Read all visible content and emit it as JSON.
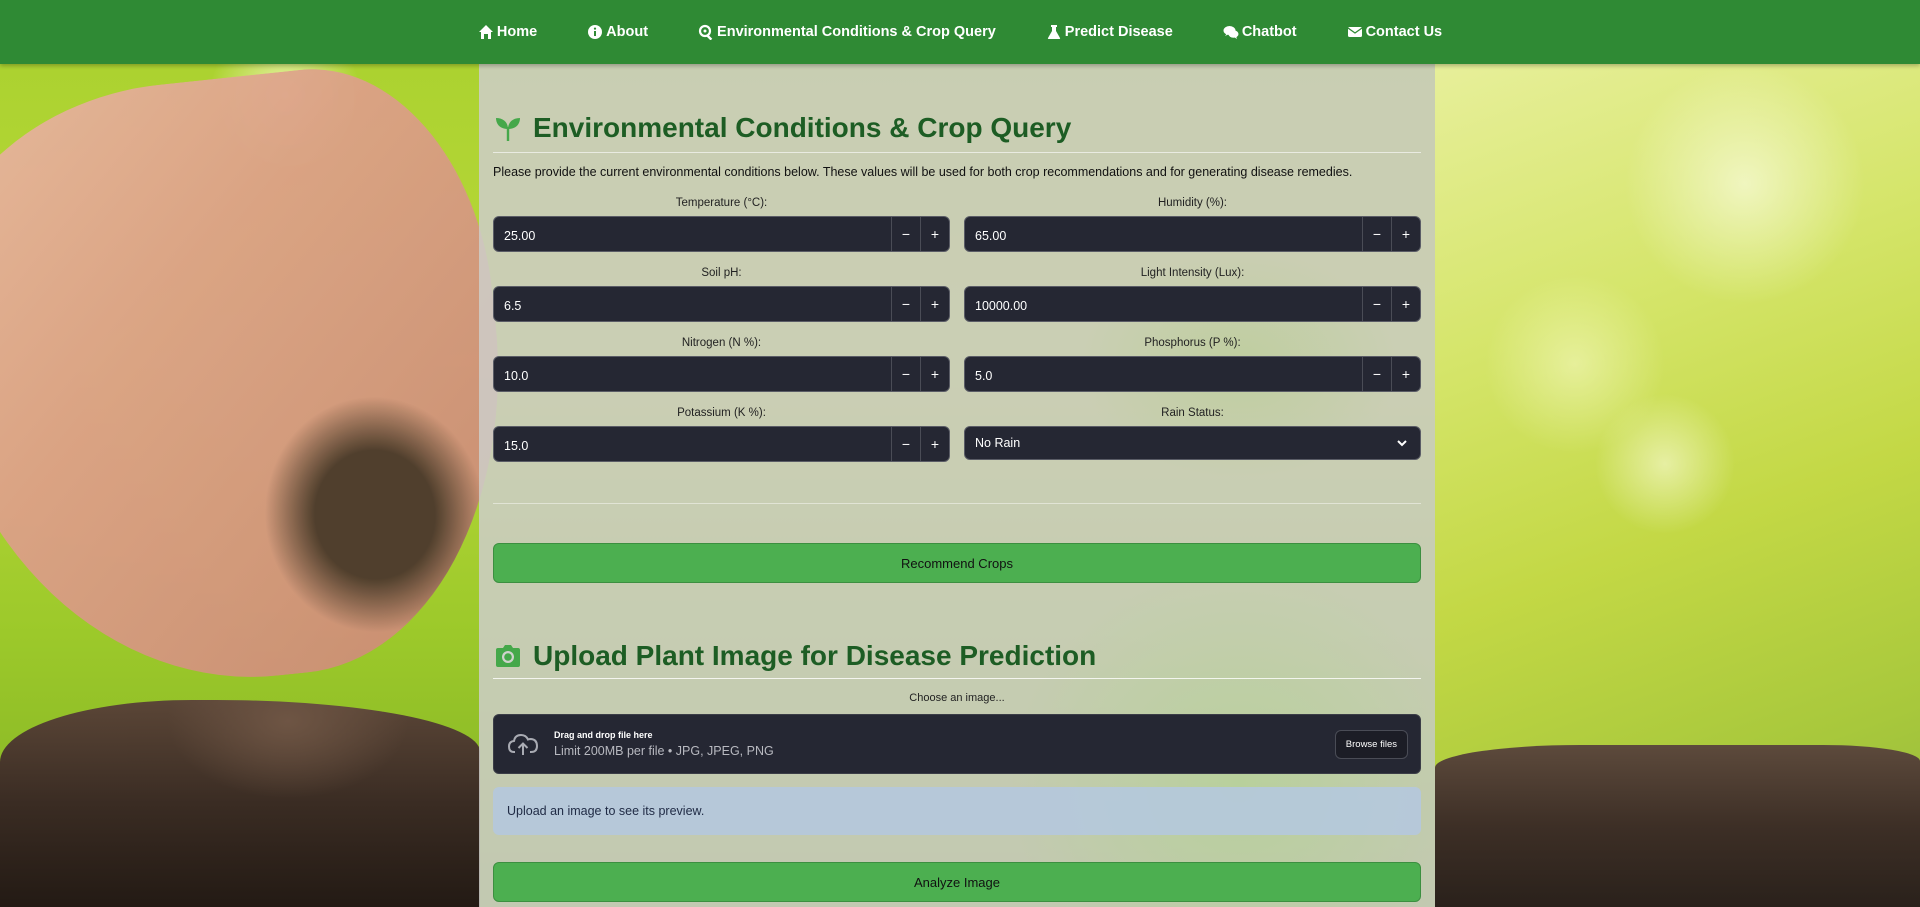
{
  "nav": {
    "items": [
      {
        "label": "Home",
        "icon": "home-icon"
      },
      {
        "label": "About",
        "icon": "info-icon"
      },
      {
        "label": "Environmental Conditions & Crop Query",
        "icon": "search-icon"
      },
      {
        "label": "Predict Disease",
        "icon": "flask-icon"
      },
      {
        "label": "Chatbot",
        "icon": "chat-icon"
      },
      {
        "label": "Contact Us",
        "icon": "envelope-icon"
      }
    ]
  },
  "env": {
    "title": "Environmental Conditions & Crop Query",
    "title_icon": "seedling-icon",
    "intro": "Please provide the current environmental conditions below. These values will be used for both crop recommendations and for generating disease remedies.",
    "fields": {
      "temperature": {
        "label": "Temperature (°C):",
        "value": "25.00"
      },
      "humidity": {
        "label": "Humidity (%):",
        "value": "65.00"
      },
      "soil_ph": {
        "label": "Soil pH:",
        "value": "6.5"
      },
      "light": {
        "label": "Light Intensity (Lux):",
        "value": "10000.00"
      },
      "nitrogen": {
        "label": "Nitrogen (N %):",
        "value": "10.0"
      },
      "phosphorus": {
        "label": "Phosphorus (P %):",
        "value": "5.0"
      },
      "potassium": {
        "label": "Potassium (K %):",
        "value": "15.0"
      },
      "rain": {
        "label": "Rain Status:",
        "value": "No Rain"
      }
    },
    "stepper_minus": "−",
    "stepper_plus": "+",
    "recommend_button": "Recommend Crops"
  },
  "upload": {
    "title": "Upload Plant Image for Disease Prediction",
    "title_icon": "camera-icon",
    "label": "Choose an image...",
    "drop_title": "Drag and drop file here",
    "drop_limit": "Limit 200MB per file • JPG, JPEG, PNG",
    "browse_button": "Browse files",
    "preview_info": "Upload an image to see its preview.",
    "analyze_button": "Analyze Image"
  },
  "colors": {
    "nav_bg": "#2f8a34",
    "accent_green": "#4caf50",
    "title_green": "#1d5d24",
    "input_bg": "#252733"
  }
}
